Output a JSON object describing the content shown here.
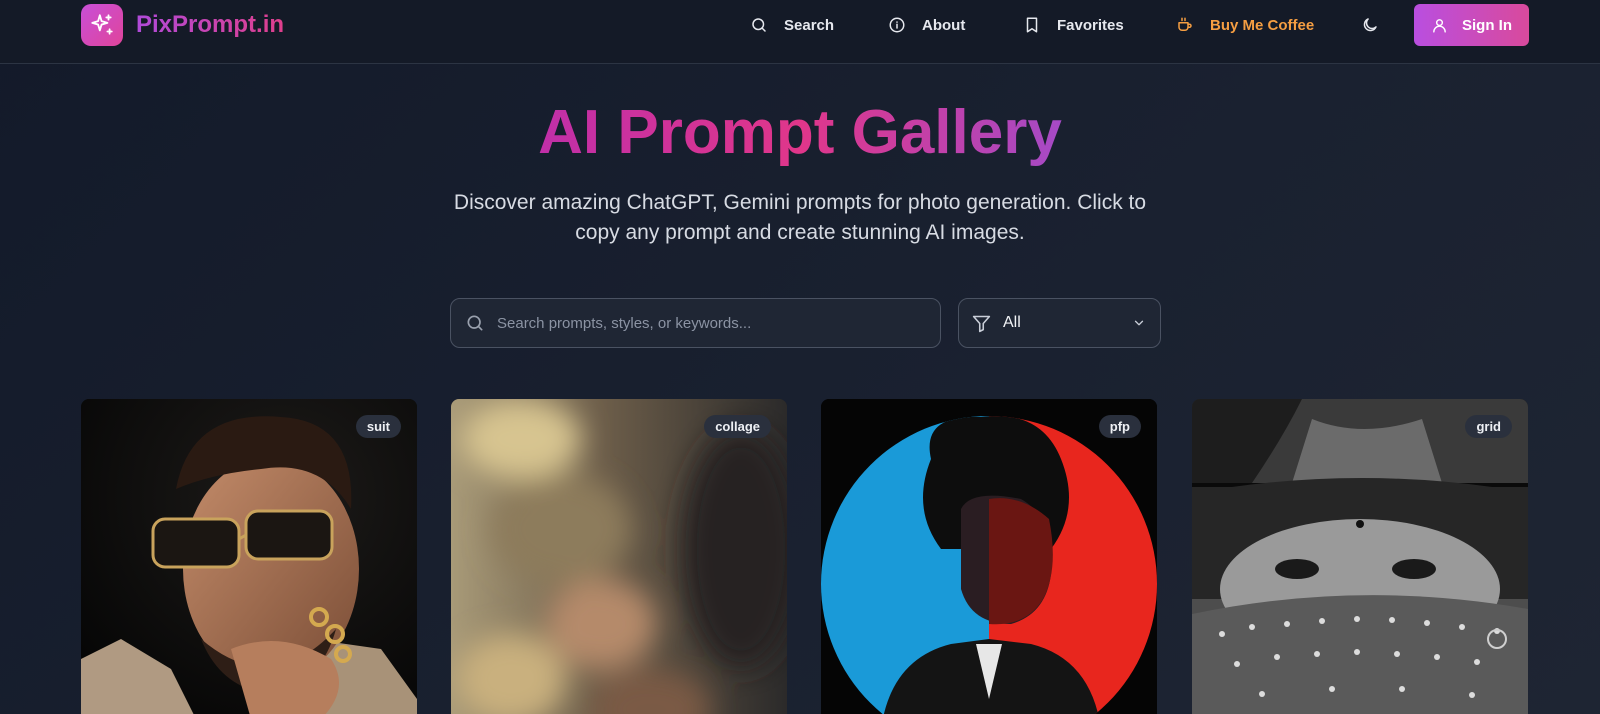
{
  "brand": {
    "name": "PixPrompt.in",
    "icon": "sparkles-icon"
  },
  "nav": {
    "search": "Search",
    "about": "About",
    "favorites": "Favorites",
    "coffee": "Buy Me Coffee",
    "signin": "Sign In"
  },
  "hero": {
    "title": "AI Prompt Gallery",
    "subtitle": "Discover amazing ChatGPT, Gemini prompts for photo generation. Click to copy any prompt and create stunning AI images."
  },
  "search": {
    "placeholder": "Search prompts, styles, or keywords...",
    "value": ""
  },
  "filter": {
    "selected": "All"
  },
  "cards": [
    {
      "tag": "suit"
    },
    {
      "tag": "collage"
    },
    {
      "tag": "pfp"
    },
    {
      "tag": "grid"
    }
  ],
  "colors": {
    "accent": "#c84fd8",
    "brand_pink": "#e0368a",
    "coffee": "#f59e42",
    "background": "#151b29"
  }
}
